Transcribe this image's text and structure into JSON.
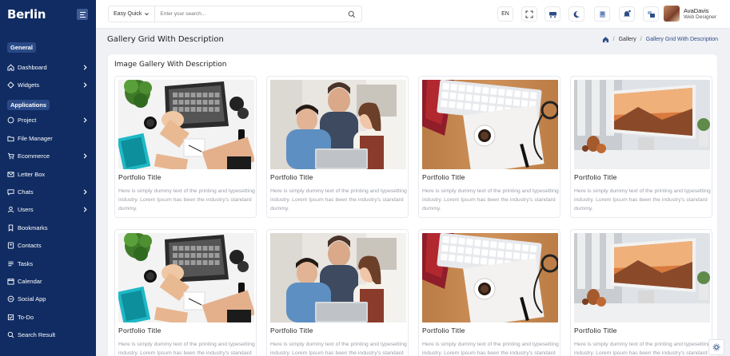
{
  "brand": {
    "name": "Berlin"
  },
  "sidebar": {
    "section_general": "General",
    "section_applications": "Applications",
    "general_items": [
      {
        "label": "Dashboard",
        "icon": "home-icon",
        "has_children": true
      },
      {
        "label": "Widgets",
        "icon": "widgets-icon",
        "has_children": true
      }
    ],
    "app_items": [
      {
        "label": "Project",
        "icon": "project-icon",
        "has_children": true
      },
      {
        "label": "File Manager",
        "icon": "folder-icon",
        "has_children": false
      },
      {
        "label": "Ecommerce",
        "icon": "cart-icon",
        "has_children": true
      },
      {
        "label": "Letter Box",
        "icon": "mail-icon",
        "has_children": false
      },
      {
        "label": "Chats",
        "icon": "chat-icon",
        "has_children": true
      },
      {
        "label": "Users",
        "icon": "user-icon",
        "has_children": true
      },
      {
        "label": "Bookmarks",
        "icon": "bookmark-icon",
        "has_children": false
      },
      {
        "label": "Contacts",
        "icon": "contacts-icon",
        "has_children": false
      },
      {
        "label": "Tasks",
        "icon": "tasks-icon",
        "has_children": false
      },
      {
        "label": "Calendar",
        "icon": "calendar-icon",
        "has_children": false
      },
      {
        "label": "Social App",
        "icon": "social-icon",
        "has_children": false
      },
      {
        "label": "To-Do",
        "icon": "todo-icon",
        "has_children": false
      },
      {
        "label": "Search Result",
        "icon": "search-icon",
        "has_children": false
      }
    ]
  },
  "header": {
    "search_scope": "Easy Quick",
    "search_placeholder": "Enter your search...",
    "language": "EN",
    "user": {
      "name": "AvaDavis",
      "role": "Web Designer"
    }
  },
  "page": {
    "title": "Gallery Grid With Description",
    "breadcrumb": [
      "Gallery",
      "Gallery Grid With Description"
    ]
  },
  "gallery": {
    "title": "Image Gallery With Description",
    "items": [
      {
        "title": "Portfolio Title",
        "description": "Here is simply dummy text of the printing and typesetting industry. Lorem Ipsum has been the industry's standard dummy.",
        "image": "workspace-desk"
      },
      {
        "title": "Portfolio Title",
        "description": "Here is simply dummy text of the printing and typesetting industry. Lorem Ipsum has been the industry's standard dummy.",
        "image": "people-laptop"
      },
      {
        "title": "Portfolio Title",
        "description": "Here is simply dummy text of the printing and typesetting industry. Lorem Ipsum has been the industry's standard dummy.",
        "image": "keyboard-coffee"
      },
      {
        "title": "Portfolio Title",
        "description": "Here is simply dummy text of the printing and typesetting industry. Lorem Ipsum has been the industry's standard dummy.",
        "image": "monitor-desk"
      },
      {
        "title": "Portfolio Title",
        "description": "Here is simply dummy text of the printing and typesetting industry. Lorem Ipsum has been the industry's standard dummy.",
        "image": "workspace-desk"
      },
      {
        "title": "Portfolio Title",
        "description": "Here is simply dummy text of the printing and typesetting industry. Lorem Ipsum has been the industry's standard dummy.",
        "image": "people-laptop"
      },
      {
        "title": "Portfolio Title",
        "description": "Here is simply dummy text of the printing and typesetting industry. Lorem Ipsum has been the industry's standard dummy.",
        "image": "keyboard-coffee"
      },
      {
        "title": "Portfolio Title",
        "description": "Here is simply dummy text of the printing and typesetting industry. Lorem Ipsum has been the industry's standard dummy.",
        "image": "monitor-desk"
      }
    ]
  },
  "colors": {
    "sidebar_bg": "#102c63",
    "accent": "#2c4d86",
    "page_bg": "#f0f1f5"
  }
}
